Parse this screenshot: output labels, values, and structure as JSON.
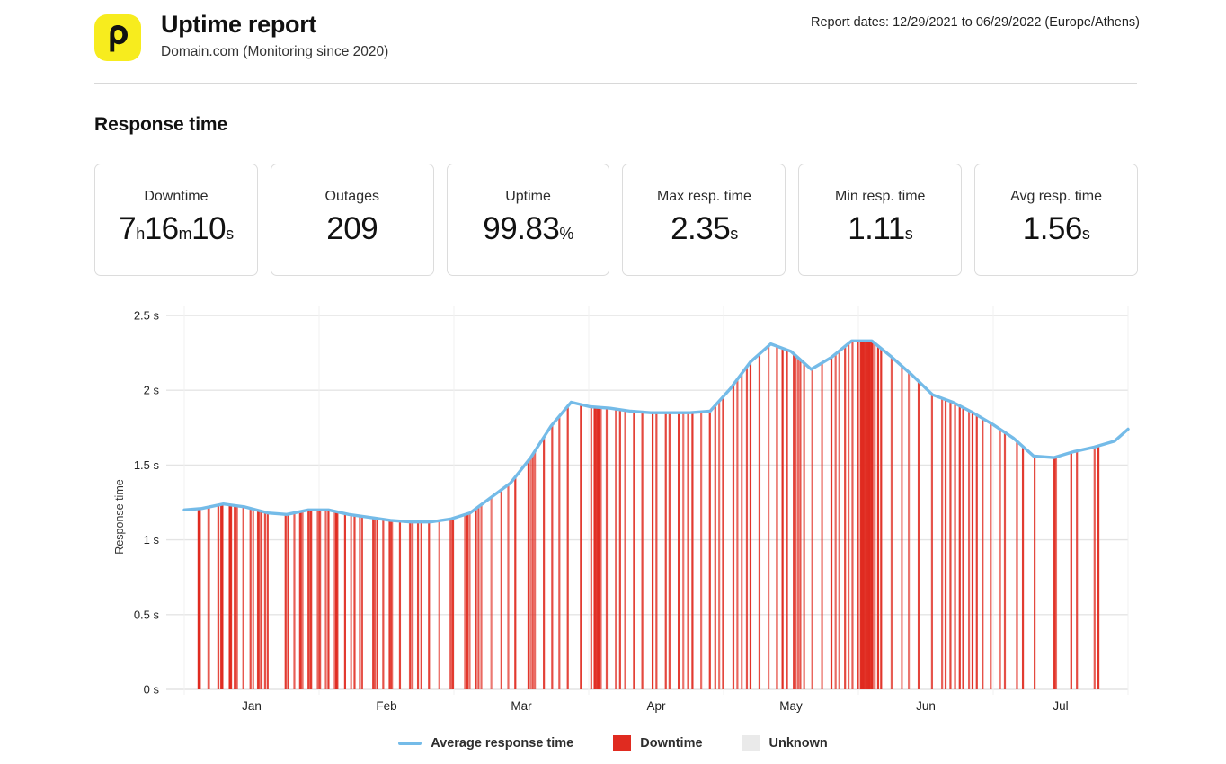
{
  "header": {
    "logo_glyph": "ρ",
    "logo_bg": "#f7ec1e",
    "title": "Uptime report",
    "subtitle": "Domain.com (Monitoring since 2020)",
    "report_dates": "Report dates: 12/29/2021 to 06/29/2022 (Europe/Athens)"
  },
  "section": {
    "title": "Response time"
  },
  "cards": [
    {
      "label": "Downtime",
      "value": "7h16m10s",
      "parts": [
        {
          "t": "7",
          "u": false
        },
        {
          "t": "h",
          "u": true
        },
        {
          "t": "16",
          "u": false
        },
        {
          "t": "m",
          "u": true
        },
        {
          "t": "10",
          "u": false
        },
        {
          "t": "s",
          "u": true
        }
      ]
    },
    {
      "label": "Outages",
      "value": "209",
      "parts": [
        {
          "t": "209",
          "u": false
        }
      ]
    },
    {
      "label": "Uptime",
      "value": "99.83%",
      "parts": [
        {
          "t": "99.83",
          "u": false
        },
        {
          "t": "%",
          "u": true
        }
      ]
    },
    {
      "label": "Max resp. time",
      "value": "2.35s",
      "parts": [
        {
          "t": "2.35",
          "u": false
        },
        {
          "t": "s",
          "u": true
        }
      ]
    },
    {
      "label": "Min resp. time",
      "value": "1.11s",
      "parts": [
        {
          "t": "1.11",
          "u": false
        },
        {
          "t": "s",
          "u": true
        }
      ]
    },
    {
      "label": "Avg resp. time",
      "value": "1.56s",
      "parts": [
        {
          "t": "1.56",
          "u": false
        },
        {
          "t": "s",
          "u": true
        }
      ]
    }
  ],
  "legend": [
    {
      "name": "average-response-time",
      "label": "Average response time",
      "marker": "line",
      "color": "#74bbe8"
    },
    {
      "name": "downtime",
      "label": "Downtime",
      "marker": "box",
      "color": "#e02b20"
    },
    {
      "name": "unknown",
      "label": "Unknown",
      "marker": "box",
      "color": "#eaeaea"
    }
  ],
  "chart_data": {
    "type": "line",
    "title": "Response time",
    "xlabel": "",
    "ylabel": "Response time",
    "ylim": [
      0,
      2.6
    ],
    "yticks": [
      0,
      0.5,
      1,
      1.5,
      2,
      2.5
    ],
    "ytick_labels": [
      "0 s",
      "0.5 s",
      "1 s",
      "1.5 s",
      "2 s",
      "2.5 s"
    ],
    "grid": true,
    "legend_position": "bottom-center",
    "xticks": [
      0.5,
      1.5,
      2.5,
      3.5,
      4.5,
      5.5,
      6.5
    ],
    "xtick_labels": [
      "Jan",
      "Feb",
      "Mar",
      "Apr",
      "May",
      "Jun",
      "Jul"
    ],
    "x_range_months": [
      0,
      7
    ],
    "series": [
      {
        "name": "Average response time",
        "color": "#74bbe8",
        "x": [
          0.0,
          0.13,
          0.29,
          0.45,
          0.62,
          0.76,
          0.92,
          1.07,
          1.22,
          1.38,
          1.53,
          1.68,
          1.83,
          1.98,
          2.12,
          2.27,
          2.42,
          2.57,
          2.72,
          2.87,
          3.01,
          3.16,
          3.31,
          3.46,
          3.6,
          3.75,
          3.9,
          4.05,
          4.2,
          4.35,
          4.5,
          4.65,
          4.8,
          4.95,
          5.1,
          5.25,
          5.4,
          5.55,
          5.7,
          5.85,
          6.0,
          6.15,
          6.3,
          6.45,
          6.6,
          6.75,
          6.9,
          7.0
        ],
        "y": [
          1.2,
          1.21,
          1.24,
          1.22,
          1.18,
          1.17,
          1.2,
          1.2,
          1.17,
          1.15,
          1.13,
          1.12,
          1.12,
          1.14,
          1.18,
          1.28,
          1.38,
          1.55,
          1.76,
          1.92,
          1.89,
          1.88,
          1.86,
          1.85,
          1.85,
          1.85,
          1.86,
          2.01,
          2.19,
          2.31,
          2.26,
          2.14,
          2.22,
          2.33,
          2.33,
          2.22,
          2.1,
          1.97,
          1.92,
          1.85,
          1.77,
          1.68,
          1.56,
          1.55,
          1.59,
          1.62,
          1.66,
          1.74
        ]
      }
    ],
    "series_tail": {
      "note": "continued line after 7th month segment collapsed into same series",
      "x": [
        7.0
      ],
      "y": [
        1.74
      ]
    },
    "downtime_color": "#e02b20",
    "downtime_events_count": 209
  }
}
